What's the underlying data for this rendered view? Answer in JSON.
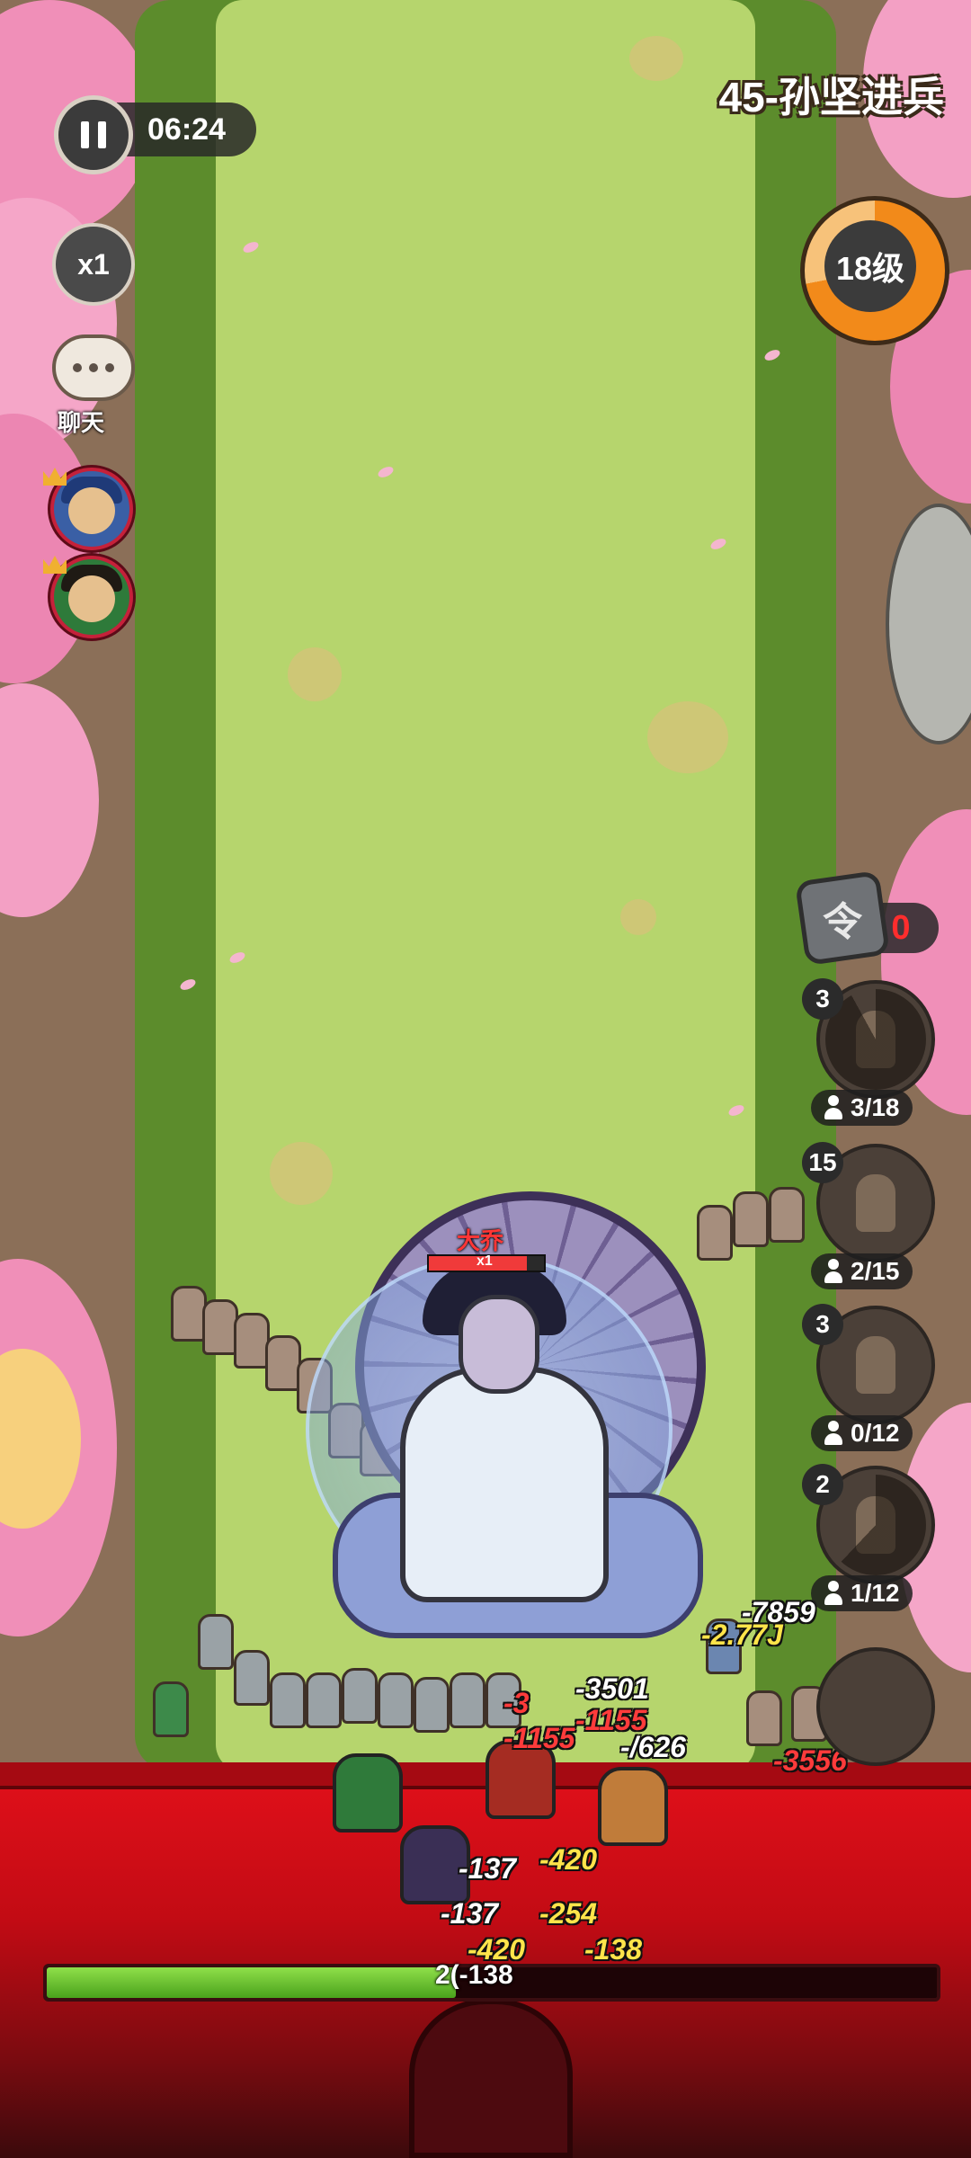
{
  "hud": {
    "timer": "06:24",
    "speed": "x1",
    "chat_label": "聊天",
    "stage_title": "45-孙坚进兵",
    "level_label": "18级",
    "level_progress": 0.72,
    "token_glyph": "令",
    "token_count": "0"
  },
  "units": [
    {
      "cost": "3",
      "count": "3/18",
      "cooldown": 0.92
    },
    {
      "cost": "15",
      "count": "2/15",
      "cooldown": 0.0
    },
    {
      "cost": "3",
      "count": "0/12",
      "cooldown": 0.0
    },
    {
      "cost": "2",
      "count": "1/12",
      "cooldown": 0.62
    }
  ],
  "boss": {
    "name": "大乔",
    "multiplier": "x1",
    "hp_fraction": 0.85
  },
  "damage_numbers": [
    {
      "text": "-7859",
      "color": "white"
    },
    {
      "text": "-2.77J",
      "color": "yellow"
    },
    {
      "text": "-3501",
      "color": "white"
    },
    {
      "text": "-1155",
      "color": "red"
    },
    {
      "text": "-1155",
      "color": "red"
    },
    {
      "text": "-3556",
      "color": "red"
    },
    {
      "text": "-/626",
      "color": "white"
    },
    {
      "text": "-137",
      "color": "white"
    },
    {
      "text": "-420",
      "color": "yellow"
    },
    {
      "text": "-137",
      "color": "white"
    },
    {
      "text": "-254",
      "color": "yellow"
    },
    {
      "text": "-420",
      "color": "yellow"
    },
    {
      "text": "-138",
      "color": "yellow"
    },
    {
      "text": "-3",
      "color": "red"
    }
  ],
  "wave_progress": {
    "fraction": 0.46,
    "label": "2(-138"
  },
  "colors": {
    "wall_red": "#e3101a",
    "road_green": "#b6d56d",
    "progress_green": "#6cc233",
    "ring_orange": "#f28a1a"
  }
}
